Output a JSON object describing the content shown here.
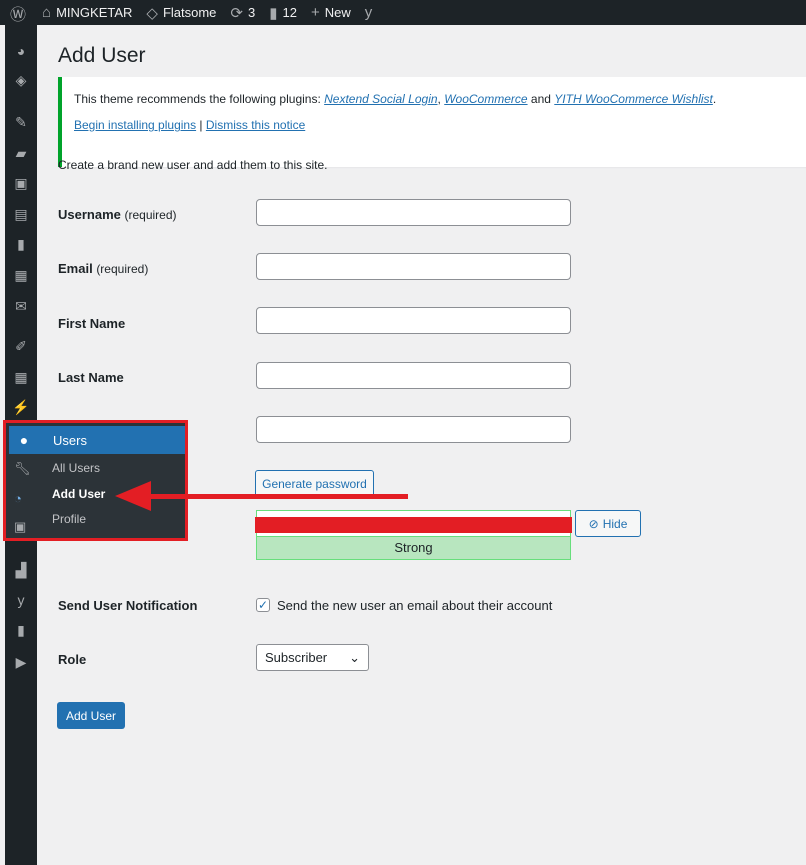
{
  "adminbar": {
    "site": "MINGKETAR",
    "theme": "Flatsome",
    "updates": "3",
    "comments": "12",
    "new": "New"
  },
  "page": {
    "title": "Add User",
    "intro": "Create a brand new user and add them to this site."
  },
  "notice": {
    "text": "This theme recommends the following plugins: ",
    "p1": "Nextend Social Login",
    "sep1": ", ",
    "p2": "WooCommerce",
    "sep2": " and ",
    "p3": "YITH WooCommerce Wishlist",
    "end": ".",
    "install": "Begin installing plugins",
    "pipe": " | ",
    "dismiss": "Dismiss this notice"
  },
  "form": {
    "username": "Username",
    "username_req": "(required)",
    "email": "Email",
    "email_req": "(required)",
    "first": "First Name",
    "last": "Last Name",
    "generate": "Generate password",
    "hide": "Hide",
    "strength": "Strong",
    "notify_label": "Send User Notification",
    "notify_text": "Send the new user an email about their account",
    "role_label": "Role",
    "role": "Subscriber",
    "submit": "Add User"
  },
  "menu": {
    "users": "Users",
    "all": "All Users",
    "add": "Add User",
    "profile": "Profile"
  }
}
